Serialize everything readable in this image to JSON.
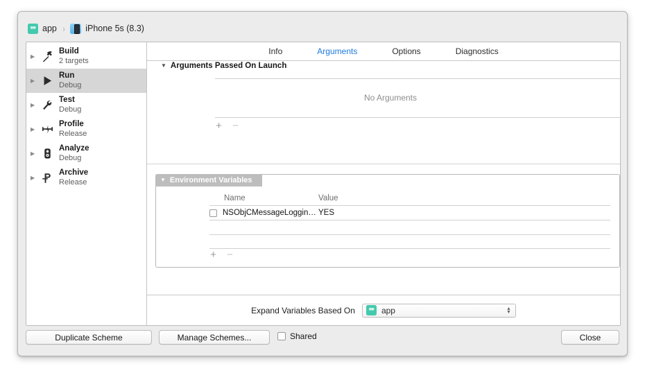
{
  "breadcrumb": {
    "app": {
      "label": "app",
      "icon": "app-target-icon",
      "glyph": "■■",
      "color": "#45c9ae"
    },
    "separator": "›",
    "device": {
      "label": "iPhone 5s (8.3)",
      "icon": "iphone-device-icon",
      "color": "#5ab1e8"
    }
  },
  "sidebar": {
    "items": [
      {
        "title": "Build",
        "subtitle": "2 targets",
        "icon": "hammer-icon",
        "selected": false
      },
      {
        "title": "Run",
        "subtitle": "Debug",
        "icon": "play-triangle-icon",
        "selected": true
      },
      {
        "title": "Test",
        "subtitle": "Debug",
        "icon": "wrench-icon",
        "selected": false
      },
      {
        "title": "Profile",
        "subtitle": "Release",
        "icon": "gauge-icon",
        "selected": false
      },
      {
        "title": "Analyze",
        "subtitle": "Debug",
        "icon": "stethoscope-icon",
        "selected": false
      },
      {
        "title": "Archive",
        "subtitle": "Release",
        "icon": "archive-box-icon",
        "selected": false
      }
    ],
    "disclosure_glyph": "▶"
  },
  "tabs": [
    {
      "label": "Info",
      "active": false
    },
    {
      "label": "Arguments",
      "active": true
    },
    {
      "label": "Options",
      "active": false
    },
    {
      "label": "Diagnostics",
      "active": false
    }
  ],
  "tab_active_color": "#1f79dd",
  "arguments_section": {
    "title": "Arguments Passed On Launch",
    "disclosure_glyph": "▼",
    "empty_message": "No Arguments",
    "add_label": "+",
    "remove_label": "−"
  },
  "environment_section": {
    "title": "Environment Variables",
    "disclosure_glyph": "▼",
    "badge_color": "#bdbdbd",
    "columns": {
      "name": "Name",
      "value": "Value"
    },
    "rows": [
      {
        "enabled": false,
        "name": "NSObjCMessageLoggin…",
        "value": "YES"
      }
    ],
    "blank_rows": 2,
    "add_label": "+",
    "remove_label": "−"
  },
  "expand_variables": {
    "label": "Expand Variables Based On",
    "selected": "app",
    "icon": "app-target-icon",
    "icon_glyph": "■■",
    "chevron_up": "▲",
    "chevron_down": "▼"
  },
  "footer": {
    "duplicate_scheme": "Duplicate Scheme",
    "manage_schemes": "Manage Schemes...",
    "shared_label": "Shared",
    "shared_checked": false,
    "close": "Close"
  }
}
